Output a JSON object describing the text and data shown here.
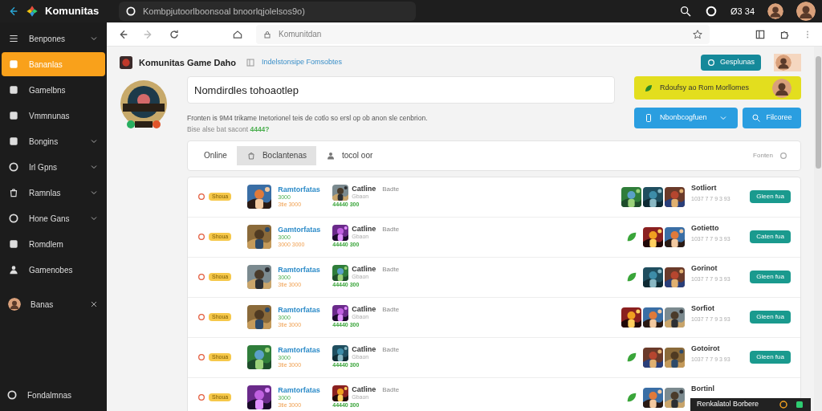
{
  "app": {
    "title": "Komunitas",
    "address": "Kombpjutoorlboonsoal bnoorlqjolelsos9o)",
    "clock": "Ø3 34"
  },
  "sidebar": {
    "items": [
      {
        "label": "Benpones",
        "selected": false,
        "expandable": true
      },
      {
        "label": "Bananlas",
        "selected": true,
        "expandable": false
      },
      {
        "label": "Gamelbns",
        "selected": false,
        "expandable": false
      },
      {
        "label": "Vmmnunas",
        "selected": false,
        "expandable": false
      },
      {
        "label": "Bongins",
        "selected": false,
        "expandable": true
      },
      {
        "label": "Irl Gpns",
        "selected": false,
        "expandable": true
      },
      {
        "label": "Ramnlas",
        "selected": false,
        "expandable": true
      },
      {
        "label": "Hone Gans",
        "selected": false,
        "expandable": true
      },
      {
        "label": "Romdlem",
        "selected": false,
        "expandable": false
      },
      {
        "label": "Gamenobes",
        "selected": false,
        "expandable": false
      }
    ],
    "profile": {
      "label": "Banas"
    },
    "footer": "Fondalmnas"
  },
  "browser": {
    "address_placeholder": "Komunitdan"
  },
  "page": {
    "title": "Komunitas Game Daho",
    "breadcrumb": "Indelstonsipe Fomsobtes",
    "top_button": "Gesplunas",
    "search_value": "Nomdirdles tohoaotlep",
    "banner": "Rdoufsy ao Rom Morllomes",
    "description": "Fronten is 9M4 trikame Inetorionel teis de cotlo so ersl op ob anon sle cenbrion.",
    "note": "Bise alse bat sacont **4444?**",
    "dropdown": "Nbonbcogfuen",
    "action_button": "Filcoree",
    "tabs": [
      {
        "label": "Online",
        "selected": false,
        "icon": false
      },
      {
        "label": "Boclantenas",
        "selected": true,
        "icon": true
      },
      {
        "label": "tocol oor",
        "selected": false,
        "icon": true
      }
    ],
    "sort": "Fonten"
  },
  "rows": [
    {
      "badge": "Shoua",
      "name": "Ramtorfatas",
      "code": "3000",
      "rating": "3tie 3000",
      "game": "Catline",
      "tag": "Badte",
      "status": "Gbaon",
      "score": "44440 300",
      "gallery": [
        {
          "kind": "picture"
        },
        {
          "kind": "picture"
        },
        {
          "kind": "picture"
        }
      ],
      "title": "Sotliort",
      "meta": "1037 7 7 9 3 93",
      "button": "Gleen fua"
    },
    {
      "badge": "Shoua",
      "name": "Gamtorfatas",
      "code": "3000",
      "rating": "3000 3000",
      "game": "Catline",
      "tag": "Badte",
      "status": "Gbaon",
      "score": "44440 300",
      "gallery": [
        {
          "kind": "icon"
        },
        {
          "kind": "picture"
        },
        {
          "kind": "picture"
        }
      ],
      "title": "Gotietto",
      "meta": "1037 7 7 9 3 93",
      "button": "Caten fua"
    },
    {
      "badge": "Shoua",
      "name": "Ramtorfatas",
      "code": "3000",
      "rating": "3tie 3000",
      "game": "Catline",
      "tag": "Badte",
      "status": "Gbaon",
      "score": "44440 300",
      "gallery": [
        {
          "kind": "icon"
        },
        {
          "kind": "picture"
        },
        {
          "kind": "picture"
        }
      ],
      "title": "Gorinot",
      "meta": "1037 7 7 9 3 93",
      "button": "Gleen fua"
    },
    {
      "badge": "Shoua",
      "name": "Ramtorfatas",
      "code": "3000",
      "rating": "3tie 3000",
      "game": "Catline",
      "tag": "Badte",
      "status": "Gbaon",
      "score": "44440 300",
      "gallery": [
        {
          "kind": "picture"
        },
        {
          "kind": "picture"
        },
        {
          "kind": "picture"
        }
      ],
      "title": "Sorfiot",
      "meta": "1037 7 7 9 3 93",
      "button": "Gleen fua"
    },
    {
      "badge": "Shoua",
      "name": "Ramtorfatas",
      "code": "3000",
      "rating": "3tie 3000",
      "game": "Catline",
      "tag": "Badte",
      "status": "Gbaon",
      "score": "44440 300",
      "gallery": [
        {
          "kind": "icon"
        },
        {
          "kind": "picture"
        },
        {
          "kind": "picture"
        }
      ],
      "title": "Gotoirot",
      "meta": "1037 7 7 9 3 93",
      "button": "Gleen fua"
    },
    {
      "badge": "Shoua",
      "name": "Ramtorfatas",
      "code": "3000",
      "rating": "3tie 3000",
      "game": "Catline",
      "tag": "Badte",
      "status": "Gbaon",
      "score": "44440 300",
      "gallery": [
        {
          "kind": "icon"
        },
        {
          "kind": "picture"
        },
        {
          "kind": "picture"
        }
      ],
      "title": "Bortinl"
    }
  ],
  "toast": "Renkalatol Borbere"
}
